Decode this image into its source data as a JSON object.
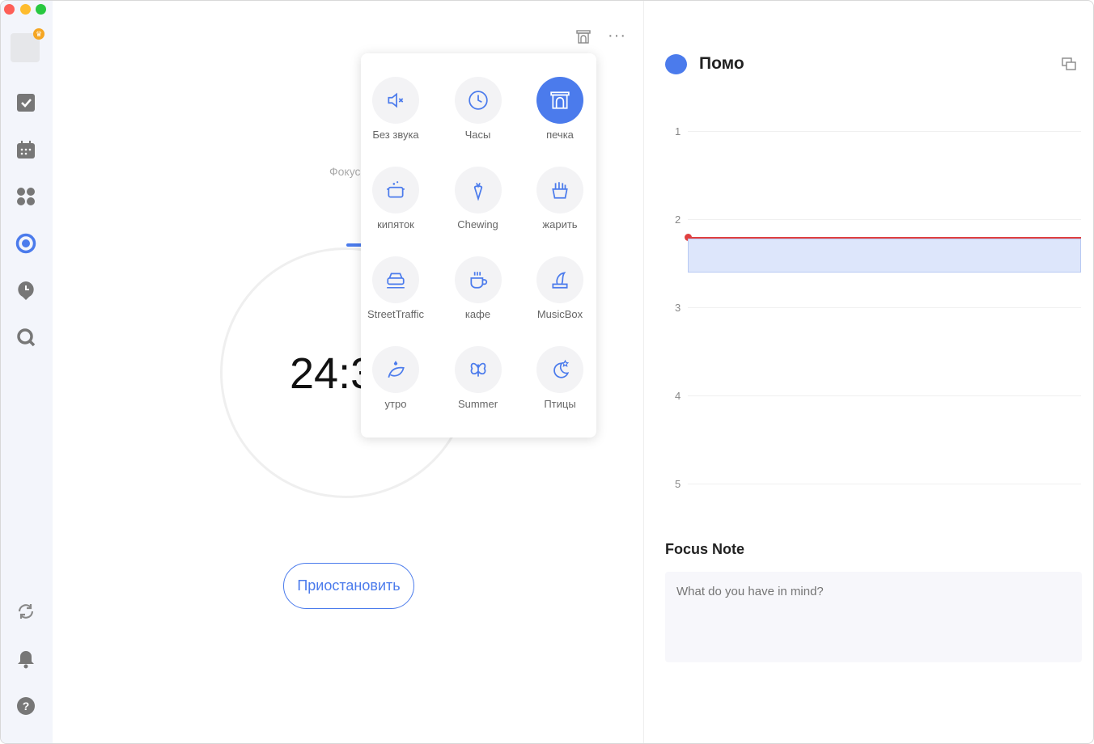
{
  "colors": {
    "accent": "#4b7bec",
    "now_line": "#e04040",
    "block": "#dde6fb"
  },
  "sidebar": {
    "icons": [
      "tasks-icon",
      "calendar-icon",
      "apps-icon",
      "pomodoro-icon",
      "habit-icon",
      "search-icon"
    ],
    "bottom_icons": [
      "sync-icon",
      "bell-icon",
      "help-icon"
    ]
  },
  "main": {
    "focus_label": "Фокус",
    "timer": "24:3",
    "pause_label": "Приостановить"
  },
  "sound_menu": {
    "items": [
      {
        "label": "Без звука",
        "icon": "mute-icon"
      },
      {
        "label": "Часы",
        "icon": "clock-icon"
      },
      {
        "label": "печка",
        "icon": "fireplace-icon",
        "active": true
      },
      {
        "label": "кипяток",
        "icon": "boiling-pot-icon"
      },
      {
        "label": "Chewing",
        "icon": "carrot-icon"
      },
      {
        "label": "жарить",
        "icon": "fries-icon"
      },
      {
        "label": "StreetTraffic",
        "icon": "car-icon"
      },
      {
        "label": "кафе",
        "icon": "coffee-cup-icon"
      },
      {
        "label": "MusicBox",
        "icon": "music-box-icon"
      },
      {
        "label": "утро",
        "icon": "leaf-drop-icon"
      },
      {
        "label": "Summer",
        "icon": "butterfly-icon"
      },
      {
        "label": "Птицы",
        "icon": "moon-star-icon"
      }
    ]
  },
  "right": {
    "title": "Помо",
    "hours": [
      "1",
      "2",
      "3",
      "4",
      "5"
    ],
    "focus_note_title": "Focus Note",
    "focus_note_placeholder": "What do you have in mind?"
  }
}
